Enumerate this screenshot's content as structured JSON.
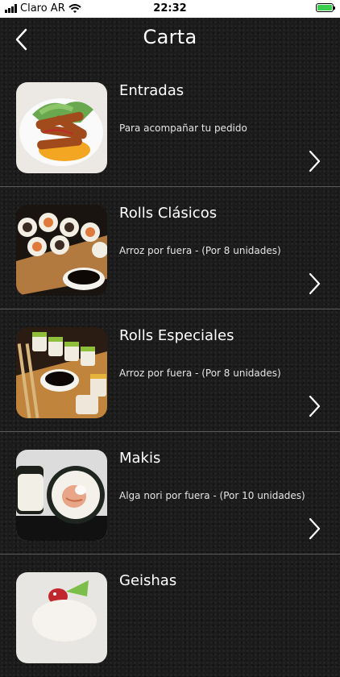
{
  "status_bar": {
    "carrier": "Claro AR",
    "time": "22:32"
  },
  "nav": {
    "title": "Carta",
    "back_icon": "chevron-left-icon"
  },
  "menu": [
    {
      "title": "Entradas",
      "subtitle": "Para acompañar tu pedido"
    },
    {
      "title": "Rolls Clásicos",
      "subtitle": "Arroz por fuera - (Por 8 unidades)"
    },
    {
      "title": "Rolls Especiales",
      "subtitle": "Arroz por fuera - (Por 8 unidades)"
    },
    {
      "title": "Makis",
      "subtitle": "Alga nori por fuera - (Por 10 unidades)"
    },
    {
      "title": "Geishas",
      "subtitle": ""
    }
  ],
  "colors": {
    "background": "#1b1b1b",
    "text": "#ffffff",
    "divider": "#5a5a5a",
    "battery": "#3ccf4e"
  }
}
